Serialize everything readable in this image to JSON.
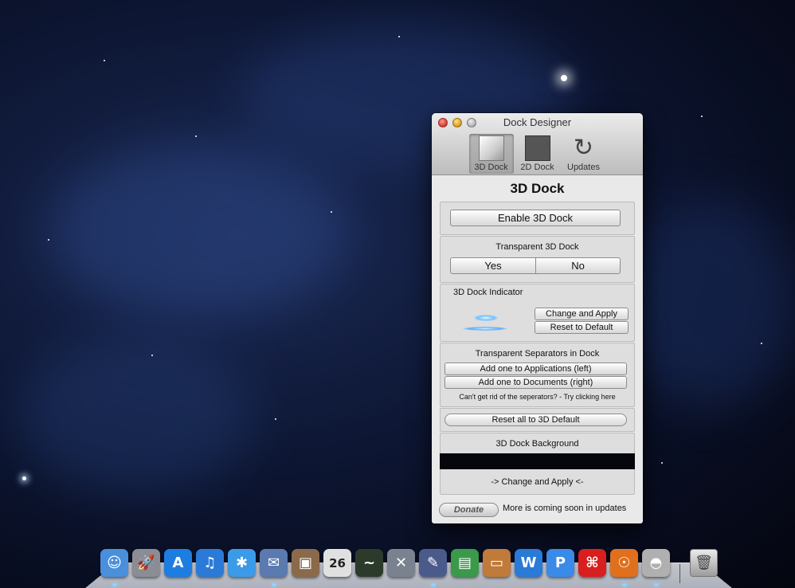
{
  "window": {
    "title": "Dock Designer",
    "tabs": [
      {
        "label": "3D Dock",
        "icon": "3d-dock-icon"
      },
      {
        "label": "2D Dock",
        "icon": "2d-dock-icon"
      },
      {
        "label": "Updates",
        "icon": "refresh-icon"
      }
    ],
    "heading": "3D Dock"
  },
  "enable_section": {
    "button": "Enable 3D Dock"
  },
  "transparent_section": {
    "title": "Transparent 3D Dock",
    "yes": "Yes",
    "no": "No"
  },
  "indicator_section": {
    "title": "3D Dock Indicator",
    "change": "Change and Apply",
    "reset": "Reset to Default"
  },
  "separators_section": {
    "title": "Transparent Separators in Dock",
    "add_apps": "Add one to Applications (left)",
    "add_docs": "Add one to Documents (right)",
    "hint": "Can't get rid of the seperators? - Try clicking here"
  },
  "reset_all": "Reset all to 3D Default",
  "background_section": {
    "title": "3D Dock Background",
    "change": "-> Change and Apply <-"
  },
  "footer": {
    "donate": "Donate",
    "note": "More is coming soon in updates"
  },
  "dock": {
    "items": [
      {
        "name": "finder-icon",
        "glyph": "☺",
        "color": "#4a8fdc"
      },
      {
        "name": "launchpad-icon",
        "glyph": "🚀",
        "color": "#8c8c94"
      },
      {
        "name": "app-store-icon",
        "glyph": "A",
        "color": "#1e7de0"
      },
      {
        "name": "itunes-icon",
        "glyph": "♫",
        "color": "#2b7ad8"
      },
      {
        "name": "safari-icon",
        "glyph": "✱",
        "color": "#3b9be8"
      },
      {
        "name": "mail-icon",
        "glyph": "✉",
        "color": "#5a7ab0"
      },
      {
        "name": "photos-icon",
        "glyph": "▣",
        "color": "#8a6a4a"
      },
      {
        "name": "calendar-icon",
        "glyph": "26",
        "color": "#e0e0e0"
      },
      {
        "name": "activity-monitor-icon",
        "glyph": "~",
        "color": "#2c3a2c"
      },
      {
        "name": "utilities-icon",
        "glyph": "✕",
        "color": "#7a8290"
      },
      {
        "name": "xcode-icon",
        "glyph": "✎",
        "color": "#4a5a8a"
      },
      {
        "name": "numbers-icon",
        "glyph": "▤",
        "color": "#3a9a4a"
      },
      {
        "name": "keynote-icon",
        "glyph": "▭",
        "color": "#c07a3a"
      },
      {
        "name": "word-icon",
        "glyph": "W",
        "color": "#2a7ad8"
      },
      {
        "name": "pro-app-icon",
        "glyph": "P",
        "color": "#3a8ae8"
      },
      {
        "name": "acrobat-icon",
        "glyph": "⌘",
        "color": "#d81e1e"
      },
      {
        "name": "firefox-icon",
        "glyph": "☉",
        "color": "#e0701e"
      },
      {
        "name": "dock-designer-icon",
        "glyph": "◓",
        "color": "#b0b0b0"
      }
    ],
    "trash_glyph": "🗑"
  }
}
